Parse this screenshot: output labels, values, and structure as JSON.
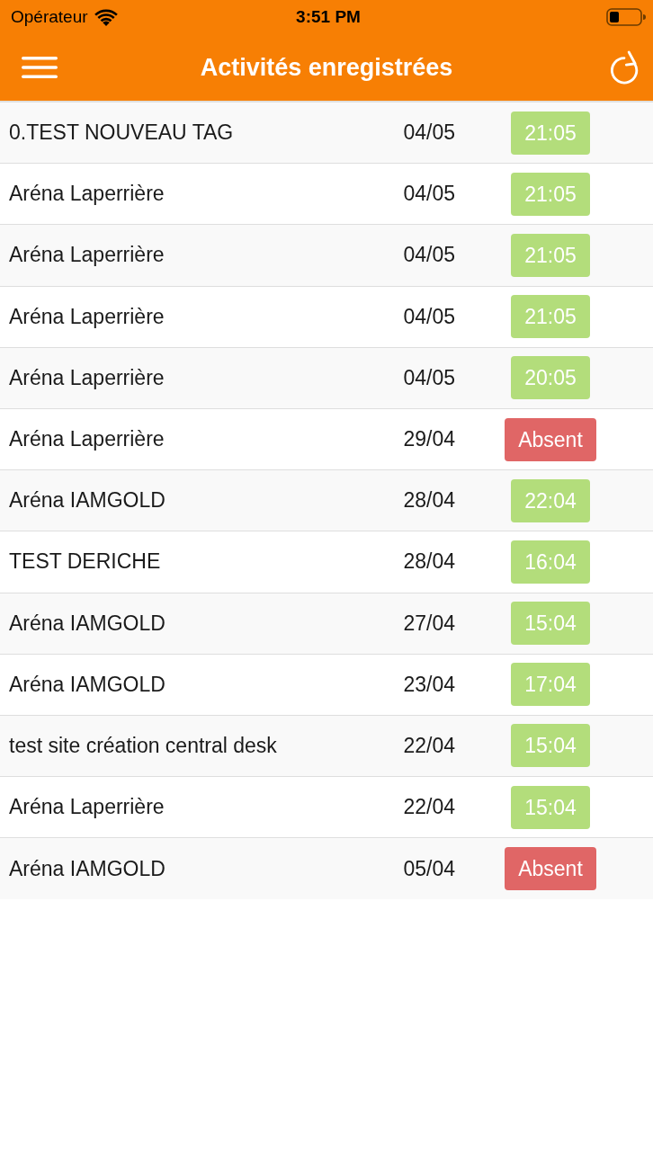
{
  "status_bar": {
    "carrier": "Opérateur",
    "time": "3:51 PM"
  },
  "nav_bar": {
    "title": "Activités enregistrées"
  },
  "activities": [
    {
      "name": "0.TEST NOUVEAU TAG",
      "date": "04/05",
      "kind": "time",
      "badge": "21:05"
    },
    {
      "name": "Aréna Laperrière",
      "date": "04/05",
      "kind": "time",
      "badge": "21:05"
    },
    {
      "name": "Aréna Laperrière",
      "date": "04/05",
      "kind": "time",
      "badge": "21:05"
    },
    {
      "name": "Aréna Laperrière",
      "date": "04/05",
      "kind": "time",
      "badge": "21:05"
    },
    {
      "name": "Aréna Laperrière",
      "date": "04/05",
      "kind": "time",
      "badge": "20:05"
    },
    {
      "name": "Aréna Laperrière",
      "date": "29/04",
      "kind": "absent",
      "badge": "Absent"
    },
    {
      "name": "Aréna IAMGOLD",
      "date": "28/04",
      "kind": "time",
      "badge": "22:04"
    },
    {
      "name": "TEST DERICHE",
      "date": "28/04",
      "kind": "time",
      "badge": "16:04"
    },
    {
      "name": "Aréna IAMGOLD",
      "date": "27/04",
      "kind": "time",
      "badge": "15:04"
    },
    {
      "name": "Aréna IAMGOLD",
      "date": "23/04",
      "kind": "time",
      "badge": "17:04"
    },
    {
      "name": "test site création central desk",
      "date": "22/04",
      "kind": "time",
      "badge": "15:04"
    },
    {
      "name": "Aréna Laperrière",
      "date": "22/04",
      "kind": "time",
      "badge": "15:04"
    },
    {
      "name": "Aréna IAMGOLD",
      "date": "05/04",
      "kind": "absent",
      "badge": "Absent"
    }
  ]
}
